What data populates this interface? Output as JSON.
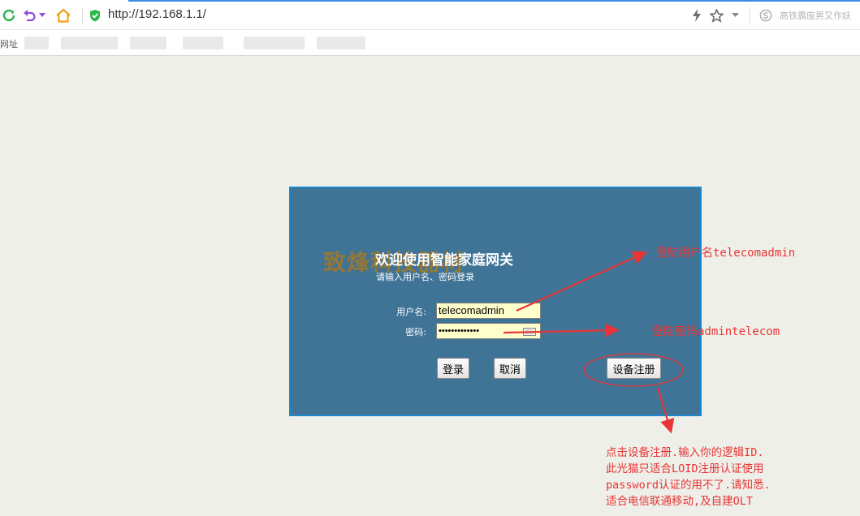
{
  "browser": {
    "address": "http://192.168.1.1/",
    "search_hint": "高铁霸座男又作妖",
    "bookmarks_label": "网址"
  },
  "login": {
    "watermark": "致烽科技器材",
    "title": "欢迎使用智能家庭网关",
    "subtitle": "请输入用户名、密码登录",
    "username_label": "用户名:",
    "username_value": "telecomadmin",
    "password_label": "密码:",
    "password_value": "•••••••••••••",
    "login_button": "登录",
    "cancel_button": "取消",
    "register_button": "设备注册"
  },
  "annotations": {
    "username_note": "登陆用户名telecomadmin",
    "password_note": "登陆密码admintelecom",
    "register_note": [
      "点击设备注册.输入你的逻辑ID.",
      "此光猫只适合LOID注册认证使用",
      "password认证的用不了.请知悉.",
      "适合电信联通移动,及自建OLT"
    ]
  },
  "colors": {
    "panel": "#407497",
    "panel_border": "#1e88cc",
    "annotation": "#e83535",
    "input_bg": "#ffffcc"
  }
}
